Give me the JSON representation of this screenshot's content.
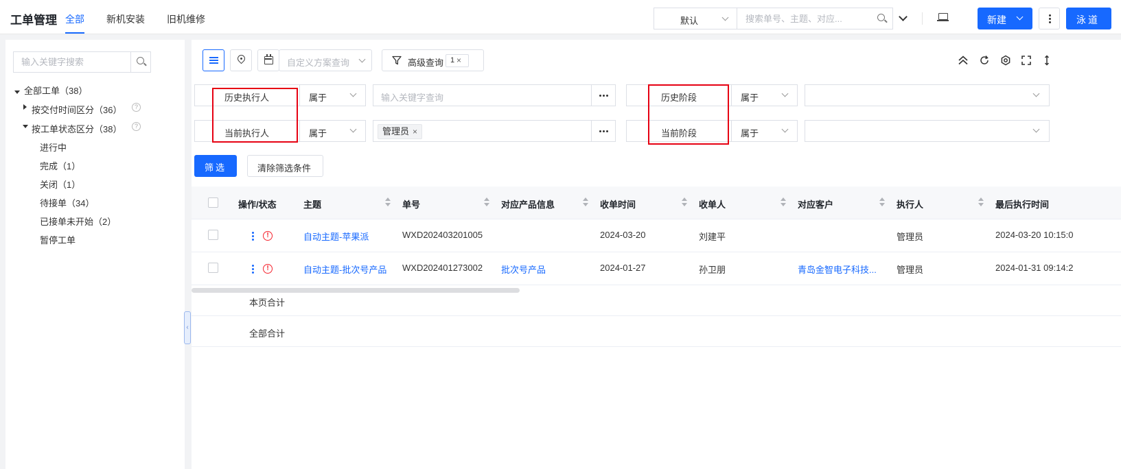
{
  "header": {
    "title": "工单管理",
    "tabs": [
      {
        "label": "全部",
        "active": true
      },
      {
        "label": "新机安装",
        "active": false
      },
      {
        "label": "旧机维修",
        "active": false
      }
    ],
    "view_select": "默认",
    "search_placeholder": "搜索单号、主题、对应...",
    "new_button": "新建",
    "user_button": "泳道"
  },
  "sidebar": {
    "search_placeholder": "输入关键字搜索",
    "tree": {
      "root": "全部工单（38）",
      "groups": [
        {
          "label": "按交付时间区分（36）",
          "expanded": false
        },
        {
          "label": "按工单状态区分（38）",
          "expanded": true
        }
      ],
      "children": [
        "进行中",
        "完成（1）",
        "关闭（1）",
        "待接单（34）",
        "已接单未开始（2）",
        "暂停工单"
      ]
    }
  },
  "toolbar": {
    "scheme_placeholder": "自定义方案查询",
    "advanced_label": "高级查询",
    "advanced_count": "1",
    "badge_close": "×"
  },
  "filters": {
    "row1": {
      "left_field": "历史执行人",
      "left_op": "属于",
      "left_value_placeholder": "输入关键字查询",
      "right_field": "历史阶段",
      "right_op": "属于"
    },
    "row2": {
      "left_field": "当前执行人",
      "left_op": "属于",
      "left_tag": "管理员",
      "tag_close": "×",
      "right_field": "当前阶段",
      "right_op": "属于"
    },
    "filter_button": "筛选",
    "clear_button": "清除筛选条件"
  },
  "table": {
    "columns": [
      "操作/状态",
      "主题",
      "单号",
      "对应产品信息",
      "收单时间",
      "收单人",
      "对应客户",
      "执行人",
      "最后执行时间"
    ],
    "rows": [
      {
        "subject": "自动主题-苹果派",
        "number": "WXD202403201005",
        "product": "",
        "received": "2024-03-20",
        "receiver": "刘建平",
        "customer": "",
        "executor": "管理员",
        "last_exec": "2024-03-20 10:15:0"
      },
      {
        "subject": "自动主题-批次号产品",
        "number": "WXD202401273002",
        "product": "批次号产品",
        "received": "2024-01-27",
        "receiver": "孙卫朋",
        "customer": "青岛金智电子科技...",
        "executor": "管理员",
        "last_exec": "2024-01-31 09:14:2"
      }
    ],
    "page_total": "本页合计",
    "all_total": "全部合计",
    "warn_glyph": "!"
  },
  "colors": {
    "accent": "#1769ff",
    "highlight_box": "#e60012",
    "warning": "#f5222d"
  }
}
